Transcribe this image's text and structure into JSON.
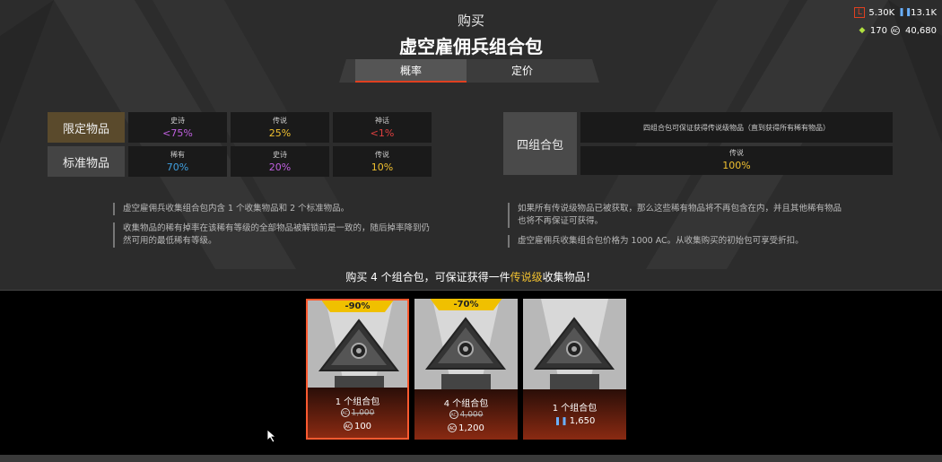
{
  "header": {
    "subtitle": "购买",
    "title": "虚空雇佣兵组合包"
  },
  "currencies": {
    "legend_tokens": "5.30K",
    "crafting_metals": "13.1K",
    "legend_shards": "170",
    "apex_coins": "40,680"
  },
  "tabs": [
    {
      "label": "概率",
      "active": true
    },
    {
      "label": "定价",
      "active": false
    }
  ],
  "odds": [
    {
      "label": "限定物品",
      "highlight": true,
      "cells": [
        {
          "rarity": "史诗",
          "value": "<75%",
          "color": "#c060e0"
        },
        {
          "rarity": "传说",
          "value": "25%",
          "color": "#f0c030"
        },
        {
          "rarity": "神话",
          "value": "<1%",
          "color": "#e04040"
        }
      ]
    },
    {
      "label": "标准物品",
      "highlight": false,
      "cells": [
        {
          "rarity": "稀有",
          "value": "70%",
          "color": "#40a0e0"
        },
        {
          "rarity": "史诗",
          "value": "20%",
          "color": "#c060e0"
        },
        {
          "rarity": "传说",
          "value": "10%",
          "color": "#f0c030"
        }
      ]
    }
  ],
  "bundle_info": {
    "label": "四组合包",
    "guarantee": "四组合包可保证获得传说级物品（直到获得所有稀有物品）",
    "rarity": "传说",
    "value": "100%"
  },
  "notes_left": [
    "虚空雇佣兵收集组合包内含 1 个收集物品和 2 个标准物品。",
    "收集物品的稀有掉率在该稀有等级的全部物品被解锁前是一致的，随后掉率降到仍然可用的最低稀有等级。"
  ],
  "notes_right": [
    "如果所有传说级物品已被获取，那么这些稀有物品将不再包含在内，并且其他稀有物品也将不再保证可获得。",
    "虚空雇佣兵收集组合包价格为 1000 AC。从收集购买的初始包可享受折扣。"
  ],
  "banner": {
    "prefix": "购买 4 个组合包，可保证获得一件",
    "highlight": "传说级",
    "suffix": "收集物品！"
  },
  "cards": [
    {
      "discount": "-90%",
      "name": "1 个组合包",
      "old_price": "1,000",
      "price": "100",
      "currency": "coin",
      "selected": true
    },
    {
      "discount": "-70%",
      "name": "4 个组合包",
      "old_price": "4,000",
      "price": "1,200",
      "currency": "coin",
      "selected": false
    },
    {
      "discount": "",
      "name": "1 个组合包",
      "old_price": "",
      "price": "1,650",
      "currency": "metals",
      "selected": false
    }
  ],
  "colors": {
    "accent": "#e04020",
    "discount": "#f0c000",
    "legendary": "#f0c030"
  }
}
